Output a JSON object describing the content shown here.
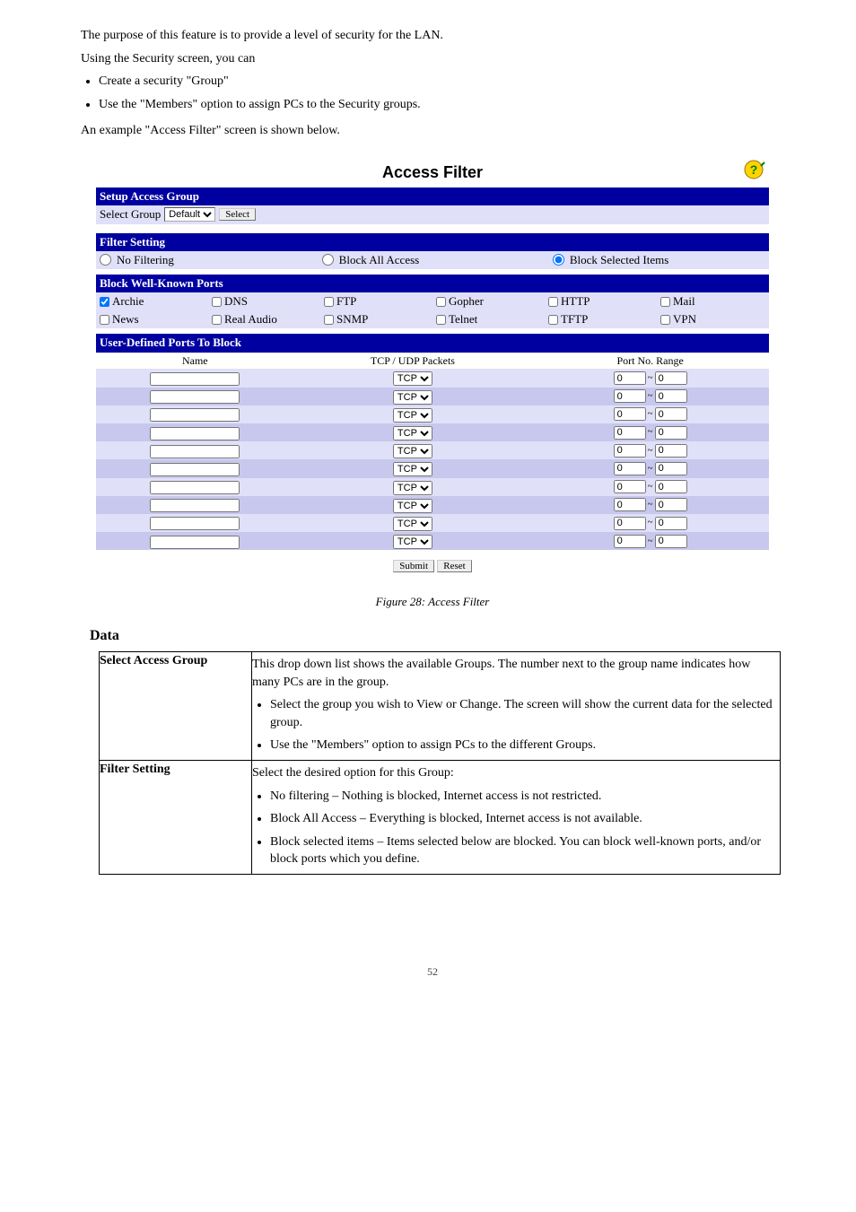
{
  "intro": {
    "purpose": "The purpose of this feature is to provide a level of security for the LAN.",
    "using_heading": "Using the Security screen, you can",
    "bullets": [
      "Create a security \"Group\" ",
      "Use the \"Members\" option to assign PCs to the Security groups."
    ],
    "example": "An example \"Access Filter\" screen is shown below."
  },
  "app": {
    "title": "Access Filter",
    "help_alt": "Help",
    "setup_group": {
      "header": "Setup Access Group",
      "label": "Select Group",
      "options": [
        "Default"
      ],
      "select_btn": "Select"
    },
    "filter_setting": {
      "header": "Filter Setting",
      "options": [
        "No Filtering",
        "Block All Access",
        "Block Selected Items"
      ],
      "selected": "Block Selected Items"
    },
    "well_known_ports": {
      "header": "Block Well-Known Ports",
      "items": [
        {
          "label": "Archie",
          "checked": true
        },
        {
          "label": "DNS",
          "checked": false
        },
        {
          "label": "FTP",
          "checked": false
        },
        {
          "label": "Gopher",
          "checked": false
        },
        {
          "label": "HTTP",
          "checked": false
        },
        {
          "label": "Mail",
          "checked": false
        },
        {
          "label": "News",
          "checked": false
        },
        {
          "label": "Real Audio",
          "checked": false
        },
        {
          "label": "SNMP",
          "checked": false
        },
        {
          "label": "Telnet",
          "checked": false
        },
        {
          "label": "TFTP",
          "checked": false
        },
        {
          "label": "VPN",
          "checked": false
        }
      ]
    },
    "user_defined": {
      "header": "User-Defined Ports To Block",
      "col_name": "Name",
      "col_proto": "TCP / UDP Packets",
      "col_range": "Port No. Range",
      "proto_default": "TCP",
      "port_default": "0",
      "tilde": "~",
      "row_count": 10
    },
    "submit_btn": "Submit",
    "reset_btn": "Reset"
  },
  "caption": "Figure 28: Access Filter",
  "data_heading": "Data",
  "table": {
    "rows": [
      {
        "left": "Select Access Group",
        "right": [
          {
            "type": "p",
            "text": "This drop down list shows the available Groups. The number next to the group name indicates how many PCs are in the group."
          },
          {
            "type": "ul",
            "items": [
              "Select the group you wish to View or Change. The screen will show the current data for the selected group.",
              "Use the \"Members\" option to assign PCs to the different Groups."
            ]
          }
        ]
      },
      {
        "left": "Filter Setting",
        "right": [
          {
            "type": "p",
            "text": "Select the desired option for this Group:"
          },
          {
            "type": "ul",
            "items": [
              "No filtering – Nothing is blocked, Internet access is not restricted.",
              "Block All Access – Everything is blocked, Internet access is not available.",
              "Block selected items – Items selected below are blocked. You can block well-known ports, and/or block ports which you define."
            ]
          }
        ]
      }
    ]
  },
  "footer": "52"
}
